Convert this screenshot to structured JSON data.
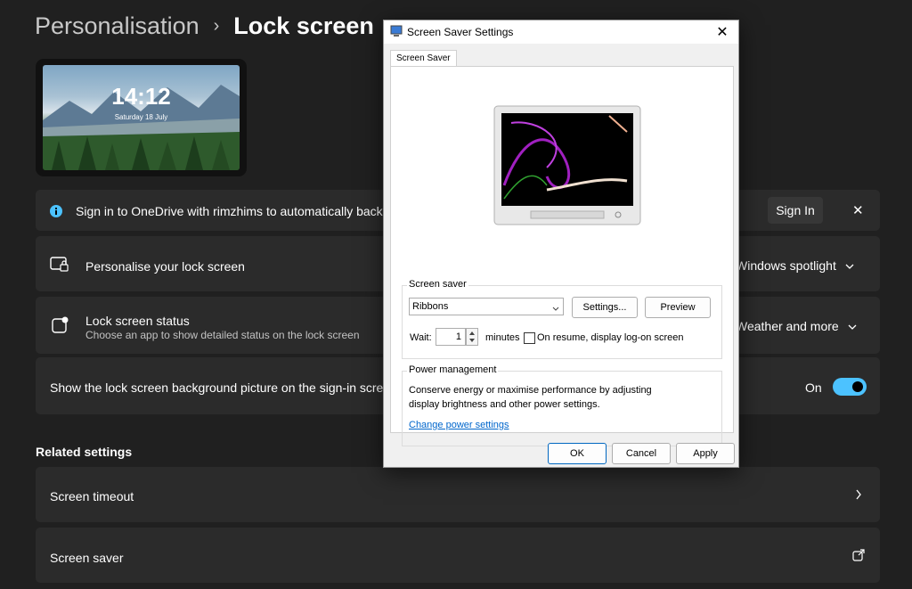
{
  "breadcrumb": {
    "parent": "Personalisation",
    "separator": "›",
    "current": "Lock screen"
  },
  "preview": {
    "time": "14:12",
    "date": "Saturday 18 July"
  },
  "onedrive": {
    "text": "Sign in to OneDrive with rimzhims to automatically back",
    "sign_in": "Sign In",
    "close": "✕"
  },
  "personalise": {
    "label": "Personalise your lock screen",
    "value": "Windows spotlight"
  },
  "status": {
    "label": "Lock screen status",
    "sublabel": "Choose an app to show detailed status on the lock screen",
    "value": "Weather and more"
  },
  "signin_bg": {
    "label": "Show the lock screen background picture on the sign-in screen",
    "toggle_label": "On"
  },
  "related": {
    "title": "Related settings",
    "items": [
      {
        "label": "Screen timeout"
      },
      {
        "label": "Screen saver"
      }
    ]
  },
  "dialog": {
    "title": "Screen Saver Settings",
    "close": "✕",
    "tab": "Screen Saver",
    "screensaver_group": "Screen saver",
    "screensaver_selected": "Ribbons",
    "settings_button": "Settings...",
    "preview_button": "Preview",
    "wait_label": "Wait:",
    "wait_value": "1",
    "minutes_label": "minutes",
    "resume_label": "On resume, display log-on screen",
    "power_group": "Power management",
    "power_text_1": "Conserve energy or maximise performance by adjusting",
    "power_text_2": "display brightness and other power settings.",
    "power_link": "Change power settings",
    "ok": "OK",
    "cancel": "Cancel",
    "apply": "Apply"
  },
  "colors": {
    "accent": "#4cc2ff",
    "background": "#202020",
    "card": "#2b2b2b"
  }
}
